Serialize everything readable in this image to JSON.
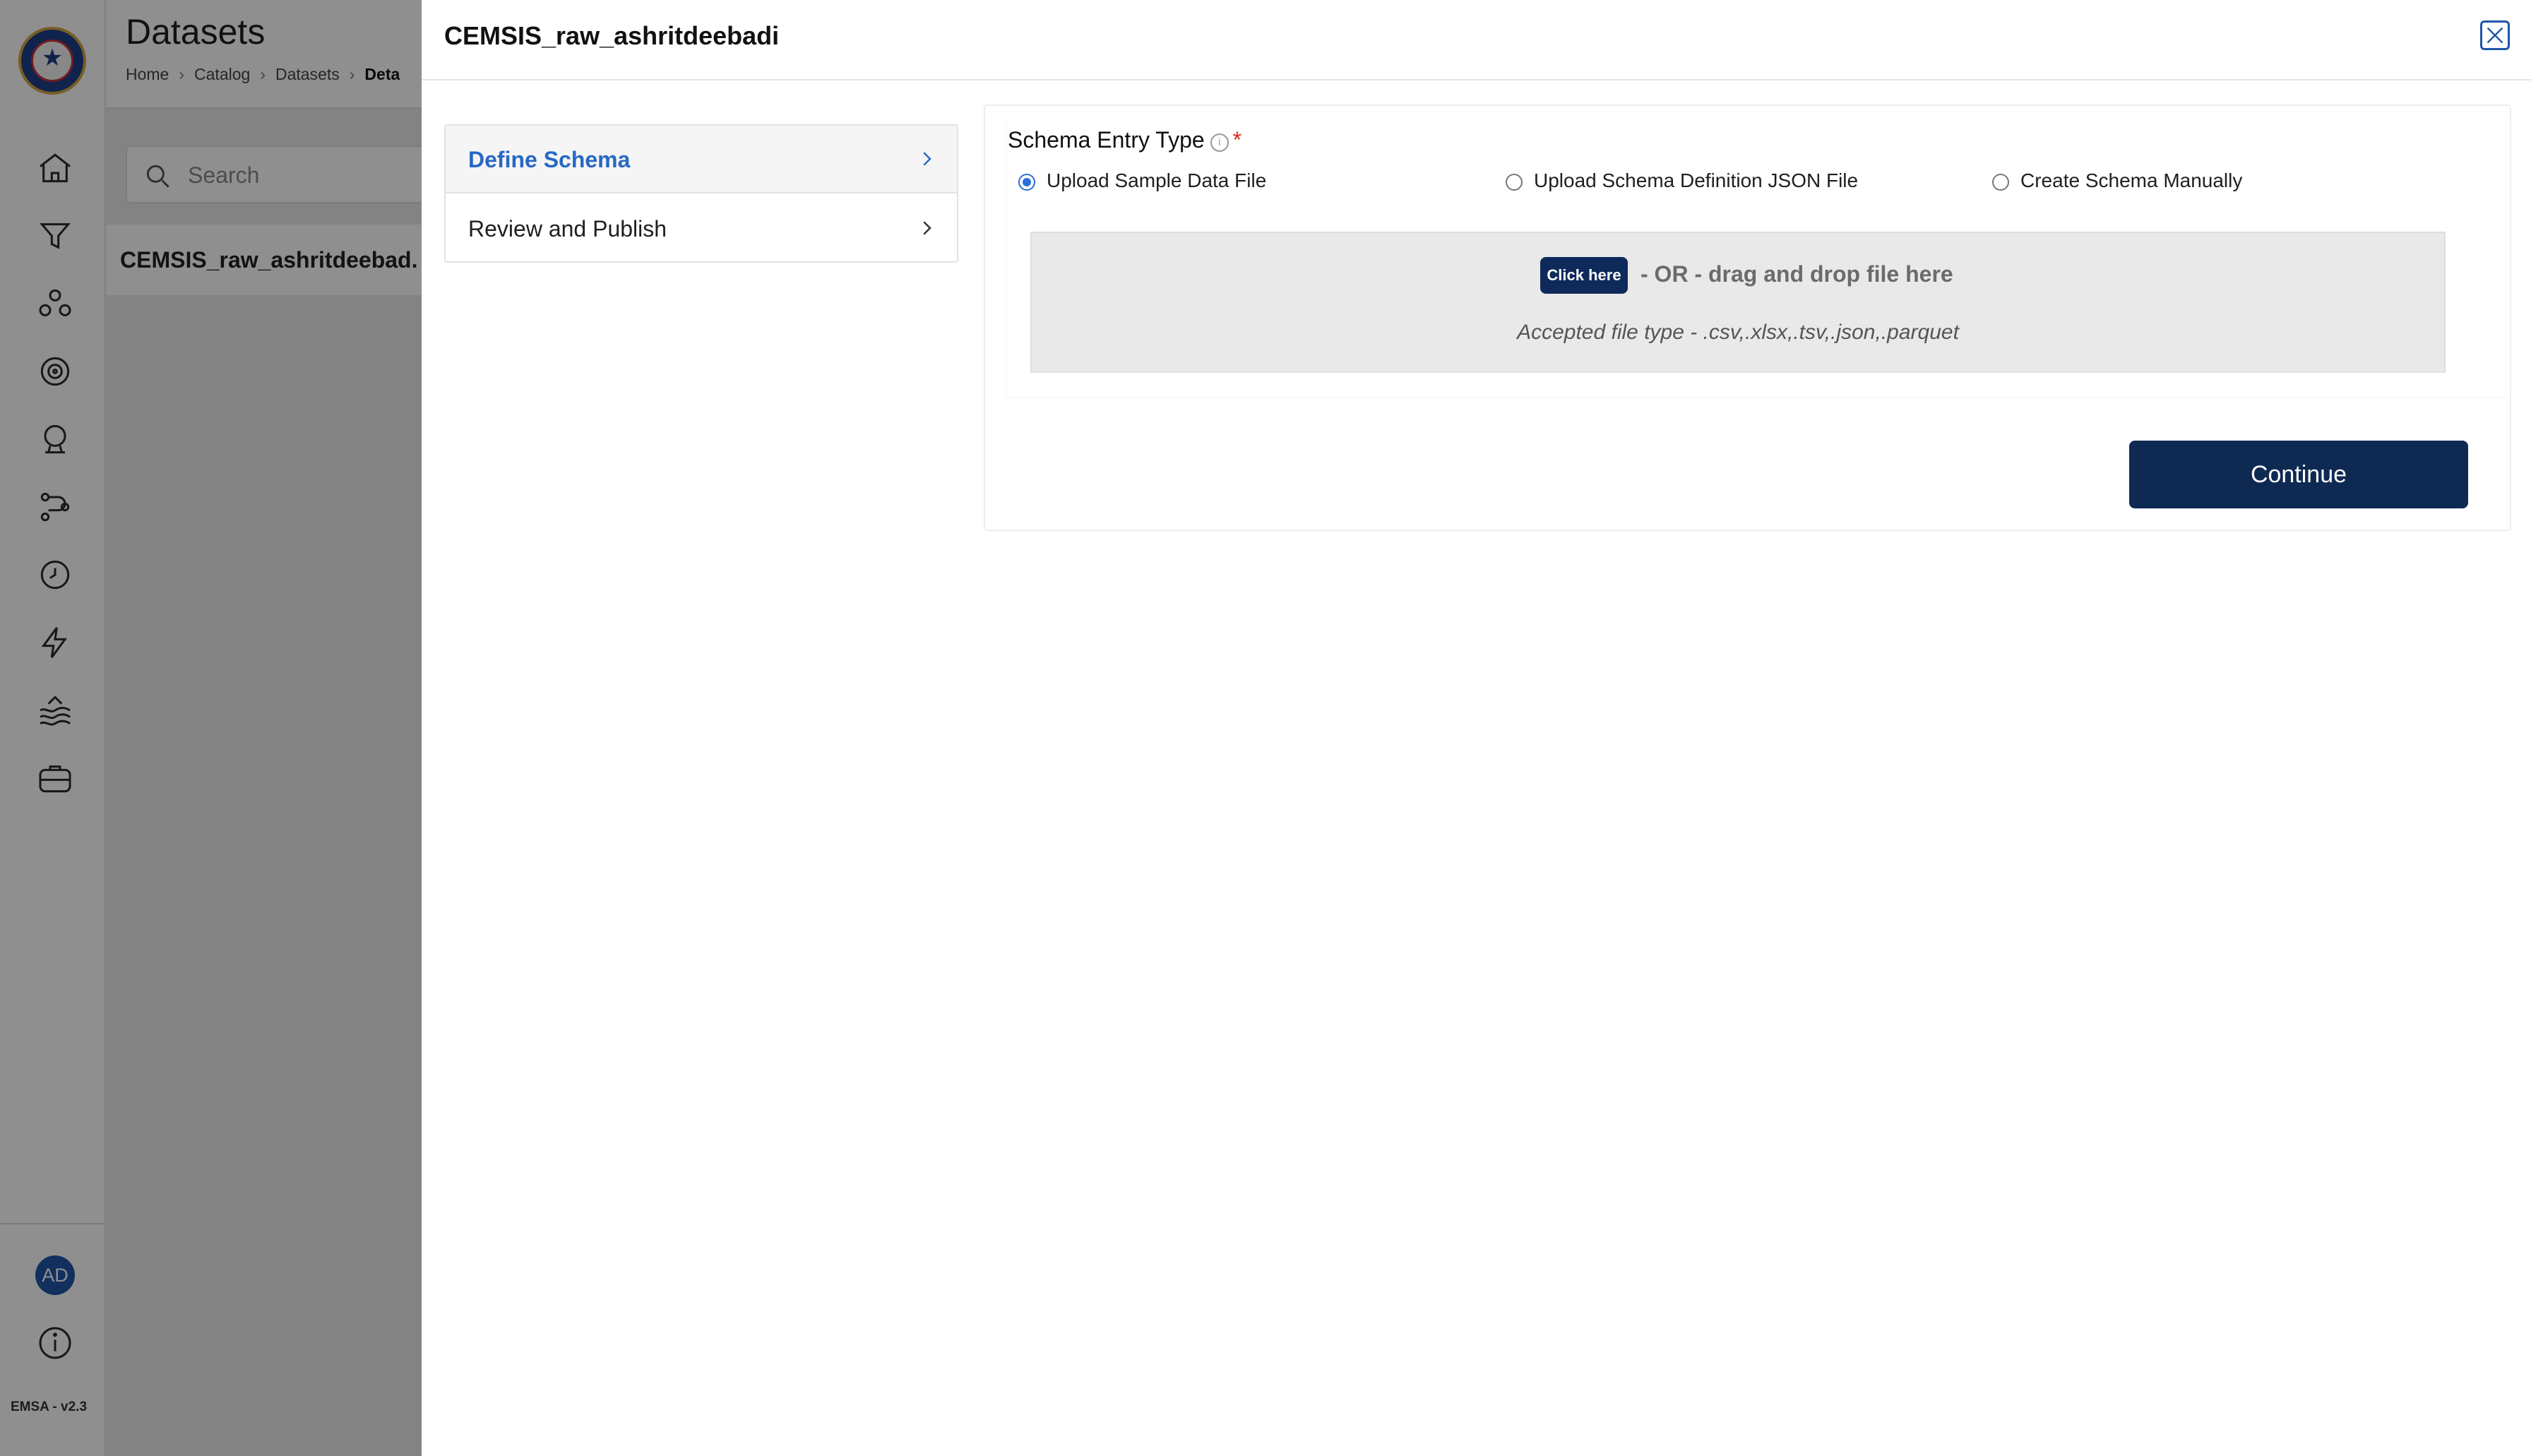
{
  "app": {
    "version": "EMSA - v2.3",
    "avatar_initials": "AD",
    "nav_icons": [
      "home-icon",
      "filter-icon",
      "nodes-icon",
      "target-icon",
      "pressure-gauge-icon",
      "workflow-icon",
      "clock-icon",
      "lightning-icon",
      "water-icon",
      "briefcase-icon"
    ]
  },
  "background": {
    "title": "Datasets",
    "breadcrumb": [
      "Home",
      "Catalog",
      "Datasets",
      "Deta"
    ],
    "search_placeholder": "Search",
    "list_item": "CEMSIS_raw_ashritdeebad..."
  },
  "drawer": {
    "title": "CEMSIS_raw_ashritdeebadi",
    "steps": [
      {
        "label": "Define Schema",
        "active": true
      },
      {
        "label": "Review and Publish",
        "active": false
      }
    ],
    "schema_entry": {
      "label": "Schema Entry Type",
      "required_mark": "*",
      "info_glyph": "i",
      "options": [
        {
          "label": "Upload Sample Data File",
          "selected": true
        },
        {
          "label": "Upload Schema Definition JSON File",
          "selected": false
        },
        {
          "label": "Create Schema Manually",
          "selected": false
        }
      ]
    },
    "dropzone": {
      "button": "Click here",
      "text": "- OR - drag and drop file here",
      "accepted": "Accepted file type - .csv,.xlsx,.tsv,.json,.parquet"
    },
    "continue_label": "Continue"
  },
  "colors": {
    "primary_dark": "#0f2a52",
    "accent_blue": "#2868c4",
    "required_red": "#e0281d",
    "overlay": "rgba(0,0,0,0.44)"
  }
}
